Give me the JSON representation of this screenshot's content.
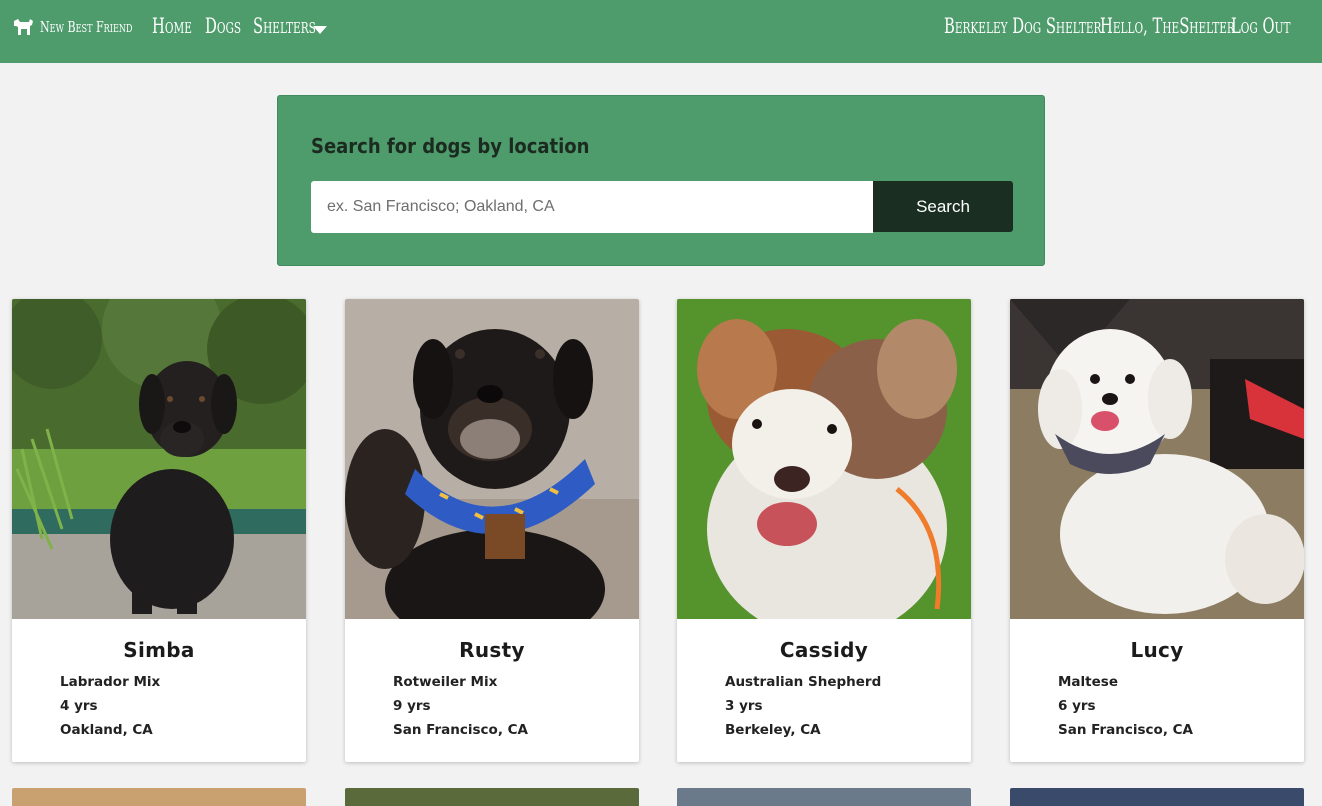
{
  "navbar": {
    "brand": "New Best Friend",
    "brand_icon": "dog-icon",
    "links": [
      "Home",
      "Dogs",
      "Shelters"
    ],
    "shelters_dropdown_icon": "caret-down-icon",
    "shelter_name": "Berkeley Dog Shelter",
    "greeting": "Hello, TheShelter",
    "logout": "Log Out",
    "color": "#4e9b6c"
  },
  "search": {
    "title": "Search for dogs by location",
    "placeholder": "ex. San Francisco; Oakland, CA",
    "value": "",
    "button_label": "Search",
    "button_color": "#1a2e22"
  },
  "dogs": [
    {
      "name": "Simba",
      "breed": "Labrador Mix",
      "age": "4 yrs",
      "location": "Oakland, CA"
    },
    {
      "name": "Rusty",
      "breed": "Rotweiler Mix",
      "age": "9 yrs",
      "location": "San Francisco, CA"
    },
    {
      "name": "Cassidy",
      "breed": "Australian Shepherd",
      "age": "3 yrs",
      "location": "Berkeley, CA"
    },
    {
      "name": "Lucy",
      "breed": "Maltese",
      "age": "6 yrs",
      "location": "San Francisco, CA"
    }
  ]
}
